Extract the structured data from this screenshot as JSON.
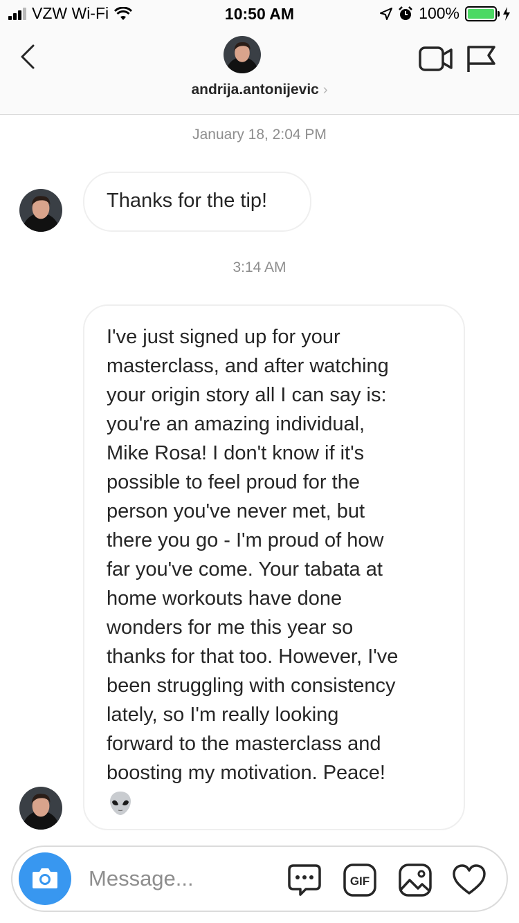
{
  "status_bar": {
    "carrier": "VZW Wi-Fi",
    "time": "10:50 AM",
    "battery_percent": "100%",
    "signal_bars_filled": 3,
    "battery_color": "#4cd964"
  },
  "header": {
    "username": "andrija.antonijevic",
    "chevron": "›",
    "icons": [
      "back-chevron-icon",
      "video-call-icon",
      "flag-icon"
    ]
  },
  "messages": [
    {
      "timestamp": "January 18, 2:04 PM"
    },
    {
      "sender": "andrija.antonijevic",
      "text": "Thanks for the tip!"
    },
    {
      "timestamp": "3:14 AM"
    },
    {
      "sender": "andrija.antonijevic",
      "lines": [
        "I've just signed up for your",
        "masterclass, and after watching",
        "your origin story all I can say is:",
        "you're an amazing individual,",
        "Mike Rosa! I don't know if it's",
        "possible to feel proud for the",
        "person you've never met, but",
        "there you go - I'm proud of how",
        "far you've come. Your tabata at",
        "home workouts have done",
        "wonders for me this year so",
        "thanks for that too. However, I've",
        "been struggling with consistency",
        "lately, so I'm really looking",
        "forward to the masterclass and",
        "boosting my motivation. Peace!"
      ],
      "emoji": "alien-emoji"
    }
  ],
  "composer": {
    "placeholder": "Message...",
    "gif_label": "GIF",
    "accent": "#3897f0",
    "icons": [
      "camera-icon",
      "chat-bubble-icon",
      "gif-icon",
      "image-icon",
      "heart-icon"
    ]
  }
}
